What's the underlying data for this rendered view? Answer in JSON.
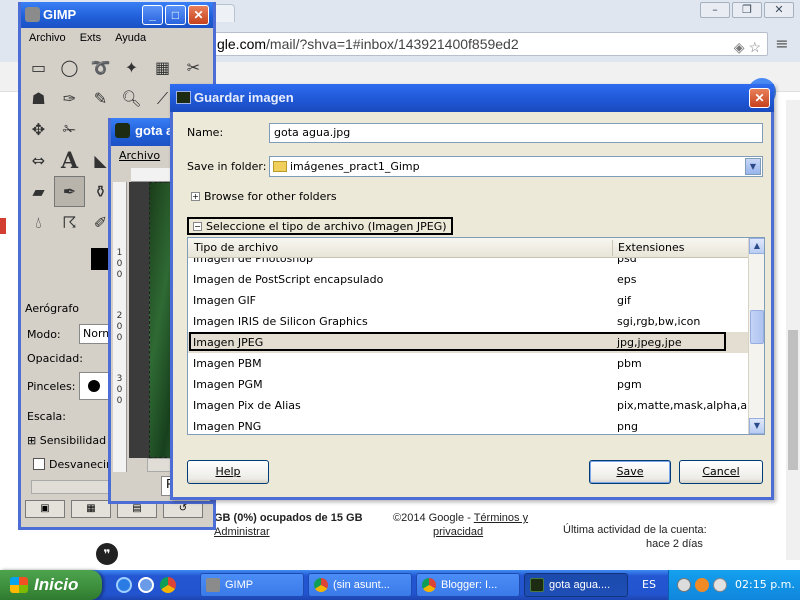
{
  "browser": {
    "url_prefix": "gle.com",
    "url_path": "/mail/?shva=1#inbox/143921400f859ed2",
    "footer": {
      "quota": "GB (0%) ocupados de 15 GB",
      "admin": "Administrar",
      "copyright_prefix": "©2014 Google - ",
      "terms": "Términos y",
      "privacy": "privacidad",
      "activity_line1": "Última actividad de la cuenta:",
      "activity_line2": "hace 2 días"
    }
  },
  "gimp": {
    "title": "GIMP",
    "menu": [
      "Archivo",
      "Exts",
      "Ayuda"
    ],
    "tool_options_title": "Aerógrafo",
    "mode_label": "Modo:",
    "mode_value": "Normal",
    "opacity_label": "Opacidad:",
    "brushes_label": "Pinceles:",
    "scale_label": "Escala:",
    "sensitivity_label": "Sensibilidad d",
    "fade_label": "Desvanecimie"
  },
  "image_window": {
    "title": "gota a",
    "menu": "Archivo",
    "ruler_v": [
      "1",
      "0",
      "0",
      "2",
      "0",
      "0",
      "3",
      "0",
      "0"
    ],
    "status": "P"
  },
  "dialog": {
    "title": "Guardar imagen",
    "name_label": "Name:",
    "name_value": "gota agua.jpg",
    "folder_label": "Save in folder:",
    "folder_value": "imágenes_pract1_Gimp",
    "browse_label": "Browse for other folders",
    "type_expander": "Seleccione el tipo de archivo (Imagen JPEG)",
    "col_type": "Tipo de archivo",
    "col_ext": "Extensiones",
    "rows": [
      {
        "type": "Imagen de Photoshop",
        "ext": "psd"
      },
      {
        "type": "Imagen de PostScript encapsulado",
        "ext": "eps"
      },
      {
        "type": "Imagen GIF",
        "ext": "gif"
      },
      {
        "type": "Imagen IRIS de Silicon Graphics",
        "ext": "sgi,rgb,bw,icon"
      },
      {
        "type": "Imagen JPEG",
        "ext": "jpg,jpeg,jpe"
      },
      {
        "type": "Imagen PBM",
        "ext": "pbm"
      },
      {
        "type": "Imagen PGM",
        "ext": "pgm"
      },
      {
        "type": "Imagen Pix de Alias",
        "ext": "pix,matte,mask,alpha,als"
      },
      {
        "type": "Imagen PNG",
        "ext": "png"
      }
    ],
    "selected_row": 4,
    "help_label": "Help",
    "save_label": "Save",
    "cancel_label": "Cancel"
  },
  "taskbar": {
    "start_label": "Inicio",
    "tasks": [
      {
        "label": "GIMP",
        "active": false
      },
      {
        "label": "(sin asunt...",
        "active": false
      },
      {
        "label": "Blogger: I...",
        "active": false
      },
      {
        "label": "gota agua....",
        "active": true
      }
    ],
    "language": "ES",
    "clock": "02:15 p.m."
  },
  "colors": {
    "xp_title_blue": "#1f5ed8",
    "selection": "#e3ded1",
    "taskbar_blue": "#2354cf",
    "start_green": "#3c8d3c"
  }
}
